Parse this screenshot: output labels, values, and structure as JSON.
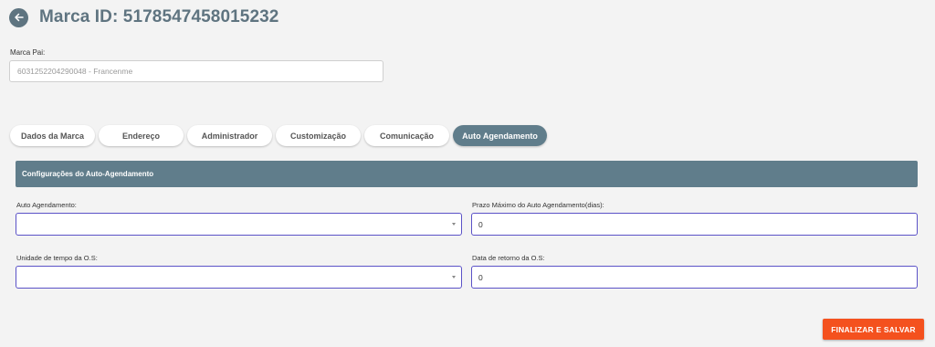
{
  "header": {
    "title": "Marca ID: 5178547458015232"
  },
  "parent": {
    "label": "Marca Pai:",
    "value": "6031252204290048 - Francenme"
  },
  "tabs": [
    {
      "label": "Dados da Marca"
    },
    {
      "label": "Endereço"
    },
    {
      "label": "Administrador"
    },
    {
      "label": "Customização"
    },
    {
      "label": "Comunicação"
    },
    {
      "label": "Auto Agendamento",
      "active": true
    }
  ],
  "section": {
    "title": "Configurações do Auto-Agendamento"
  },
  "fields": {
    "auto_agendamento": {
      "label": "Auto Agendamento:",
      "value": ""
    },
    "prazo_maximo": {
      "label": "Prazo Máximo do Auto Agendamento(dias):",
      "value": "0"
    },
    "unidade_tempo": {
      "label": "Unidade de tempo da O.S:",
      "value": ""
    },
    "data_retorno": {
      "label": "Data de retorno da O.S:",
      "value": "0"
    }
  },
  "actions": {
    "submit_label": "FINALIZAR E SALVAR"
  },
  "colors": {
    "accent": "#607d8b",
    "submit": "#f4511e",
    "field_border": "#5b52c7"
  },
  "icons": {
    "back": "arrow-left-icon",
    "dropdown": "caret-down-icon"
  }
}
